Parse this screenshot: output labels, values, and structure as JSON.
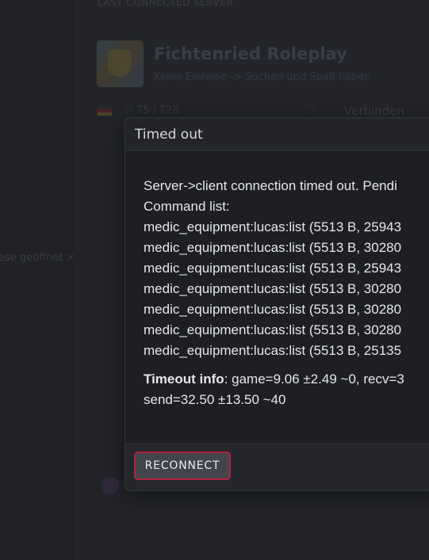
{
  "background": {
    "section_heading": "LAST CONNECTED SERVER",
    "server_name": "Fichtenried Roleplay",
    "server_description": "Keine Einreise -> Suchen und Spaß haben",
    "players": "75 / 128",
    "connect_label": "Verbinden",
    "heart_icon": "heart-icon",
    "toast_text": "ese geöffnet ×"
  },
  "modal": {
    "title": "Timed out",
    "message_lines": [
      "Server->client connection timed out. Pendi",
      "Command list:",
      "medic_equipment:lucas:list (5513 B, 25943",
      "medic_equipment:lucas:list (5513 B, 30280",
      "medic_equipment:lucas:list (5513 B, 25943",
      "medic_equipment:lucas:list (5513 B, 30280",
      "medic_equipment:lucas:list (5513 B, 30280",
      "medic_equipment:lucas:list (5513 B, 30280",
      "medic_equipment:lucas:list (5513 B, 25135"
    ],
    "timeout_info_label": "Timeout info",
    "timeout_info_rest": ": game=9.06 ±2.49 ~0, recv=3",
    "timeout_info_line2": "send=32.50 ±13.50 ~40",
    "reconnect_label": "RECONNECT",
    "accent_color": "#b0243f"
  }
}
